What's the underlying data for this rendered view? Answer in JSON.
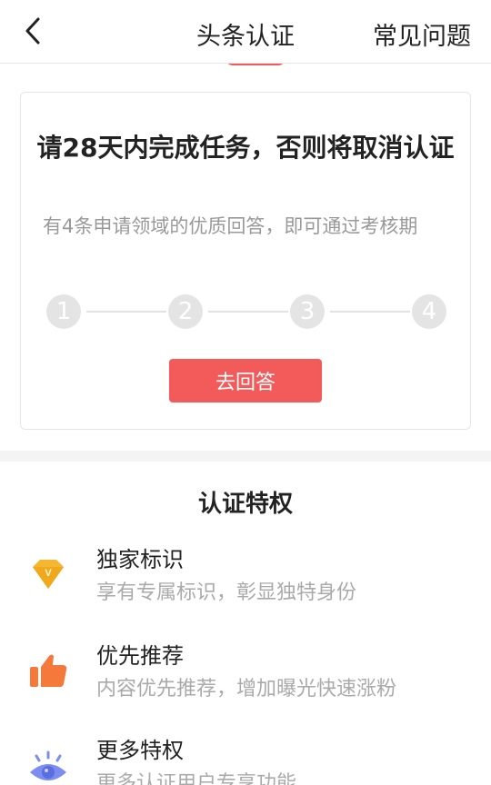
{
  "header": {
    "title": "头条认证",
    "faq_label": "常见问题"
  },
  "task": {
    "title": "请28天内完成任务，否则将取消认证",
    "description": "有4条申请领域的优质回答，即可通过考核期",
    "steps": [
      "1",
      "2",
      "3",
      "4"
    ],
    "button_label": "去回答"
  },
  "privileges": {
    "title": "认证特权",
    "items": [
      {
        "name": "独家标识",
        "description": "享有专属标识，彰显独特身份",
        "icon": "diamond-v-icon",
        "color": "#f5b731"
      },
      {
        "name": "优先推荐",
        "description": "内容优先推荐，增加曝光快速涨粉",
        "icon": "thumbs-up-icon",
        "color": "#f4793b"
      },
      {
        "name": "更多特权",
        "description": "更多认证用户专享功能",
        "icon": "eye-icon",
        "color": "#7b8df0"
      }
    ]
  },
  "colors": {
    "accent": "#f35b5b",
    "step_inactive": "#e4e4e4",
    "muted_text": "#999999"
  }
}
